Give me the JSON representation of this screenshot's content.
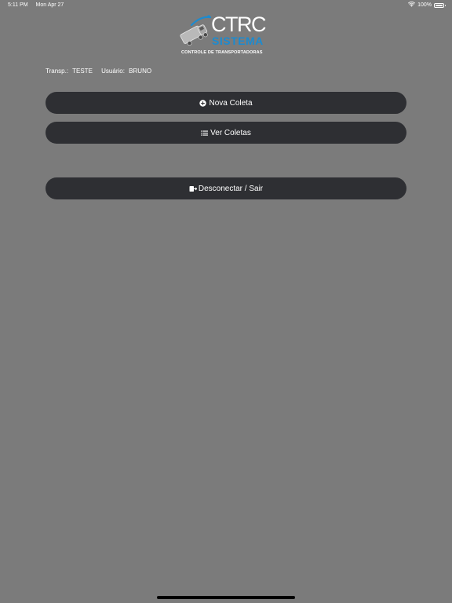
{
  "status_bar": {
    "time": "5:11 PM",
    "date": "Mon Apr 27",
    "battery_text": "100%",
    "battery_level": 1.0,
    "wifi_icon": "wifi-icon",
    "battery_icon": "battery-icon"
  },
  "logo": {
    "title": "CTRC",
    "subtitle": "SISTEMA",
    "tagline": "CONTROLE DE TRANSPORTADORAS",
    "accent_color": "#1c8bd0"
  },
  "info": {
    "transp_label": "Transp.:",
    "transp_value": "TESTE",
    "usuario_label": "Usuário:",
    "usuario_value": "BRUNO"
  },
  "buttons": {
    "nova_coleta": {
      "label": "Nova Coleta",
      "icon": "plus-circle-icon"
    },
    "ver_coletas": {
      "label": "Ver Coletas",
      "icon": "list-icon"
    },
    "sair": {
      "label": "Desconectar / Sair",
      "icon": "sign-out-icon"
    }
  },
  "colors": {
    "background": "#7b7b7b",
    "button_bg": "#2e2f33",
    "text": "#ffffff"
  }
}
